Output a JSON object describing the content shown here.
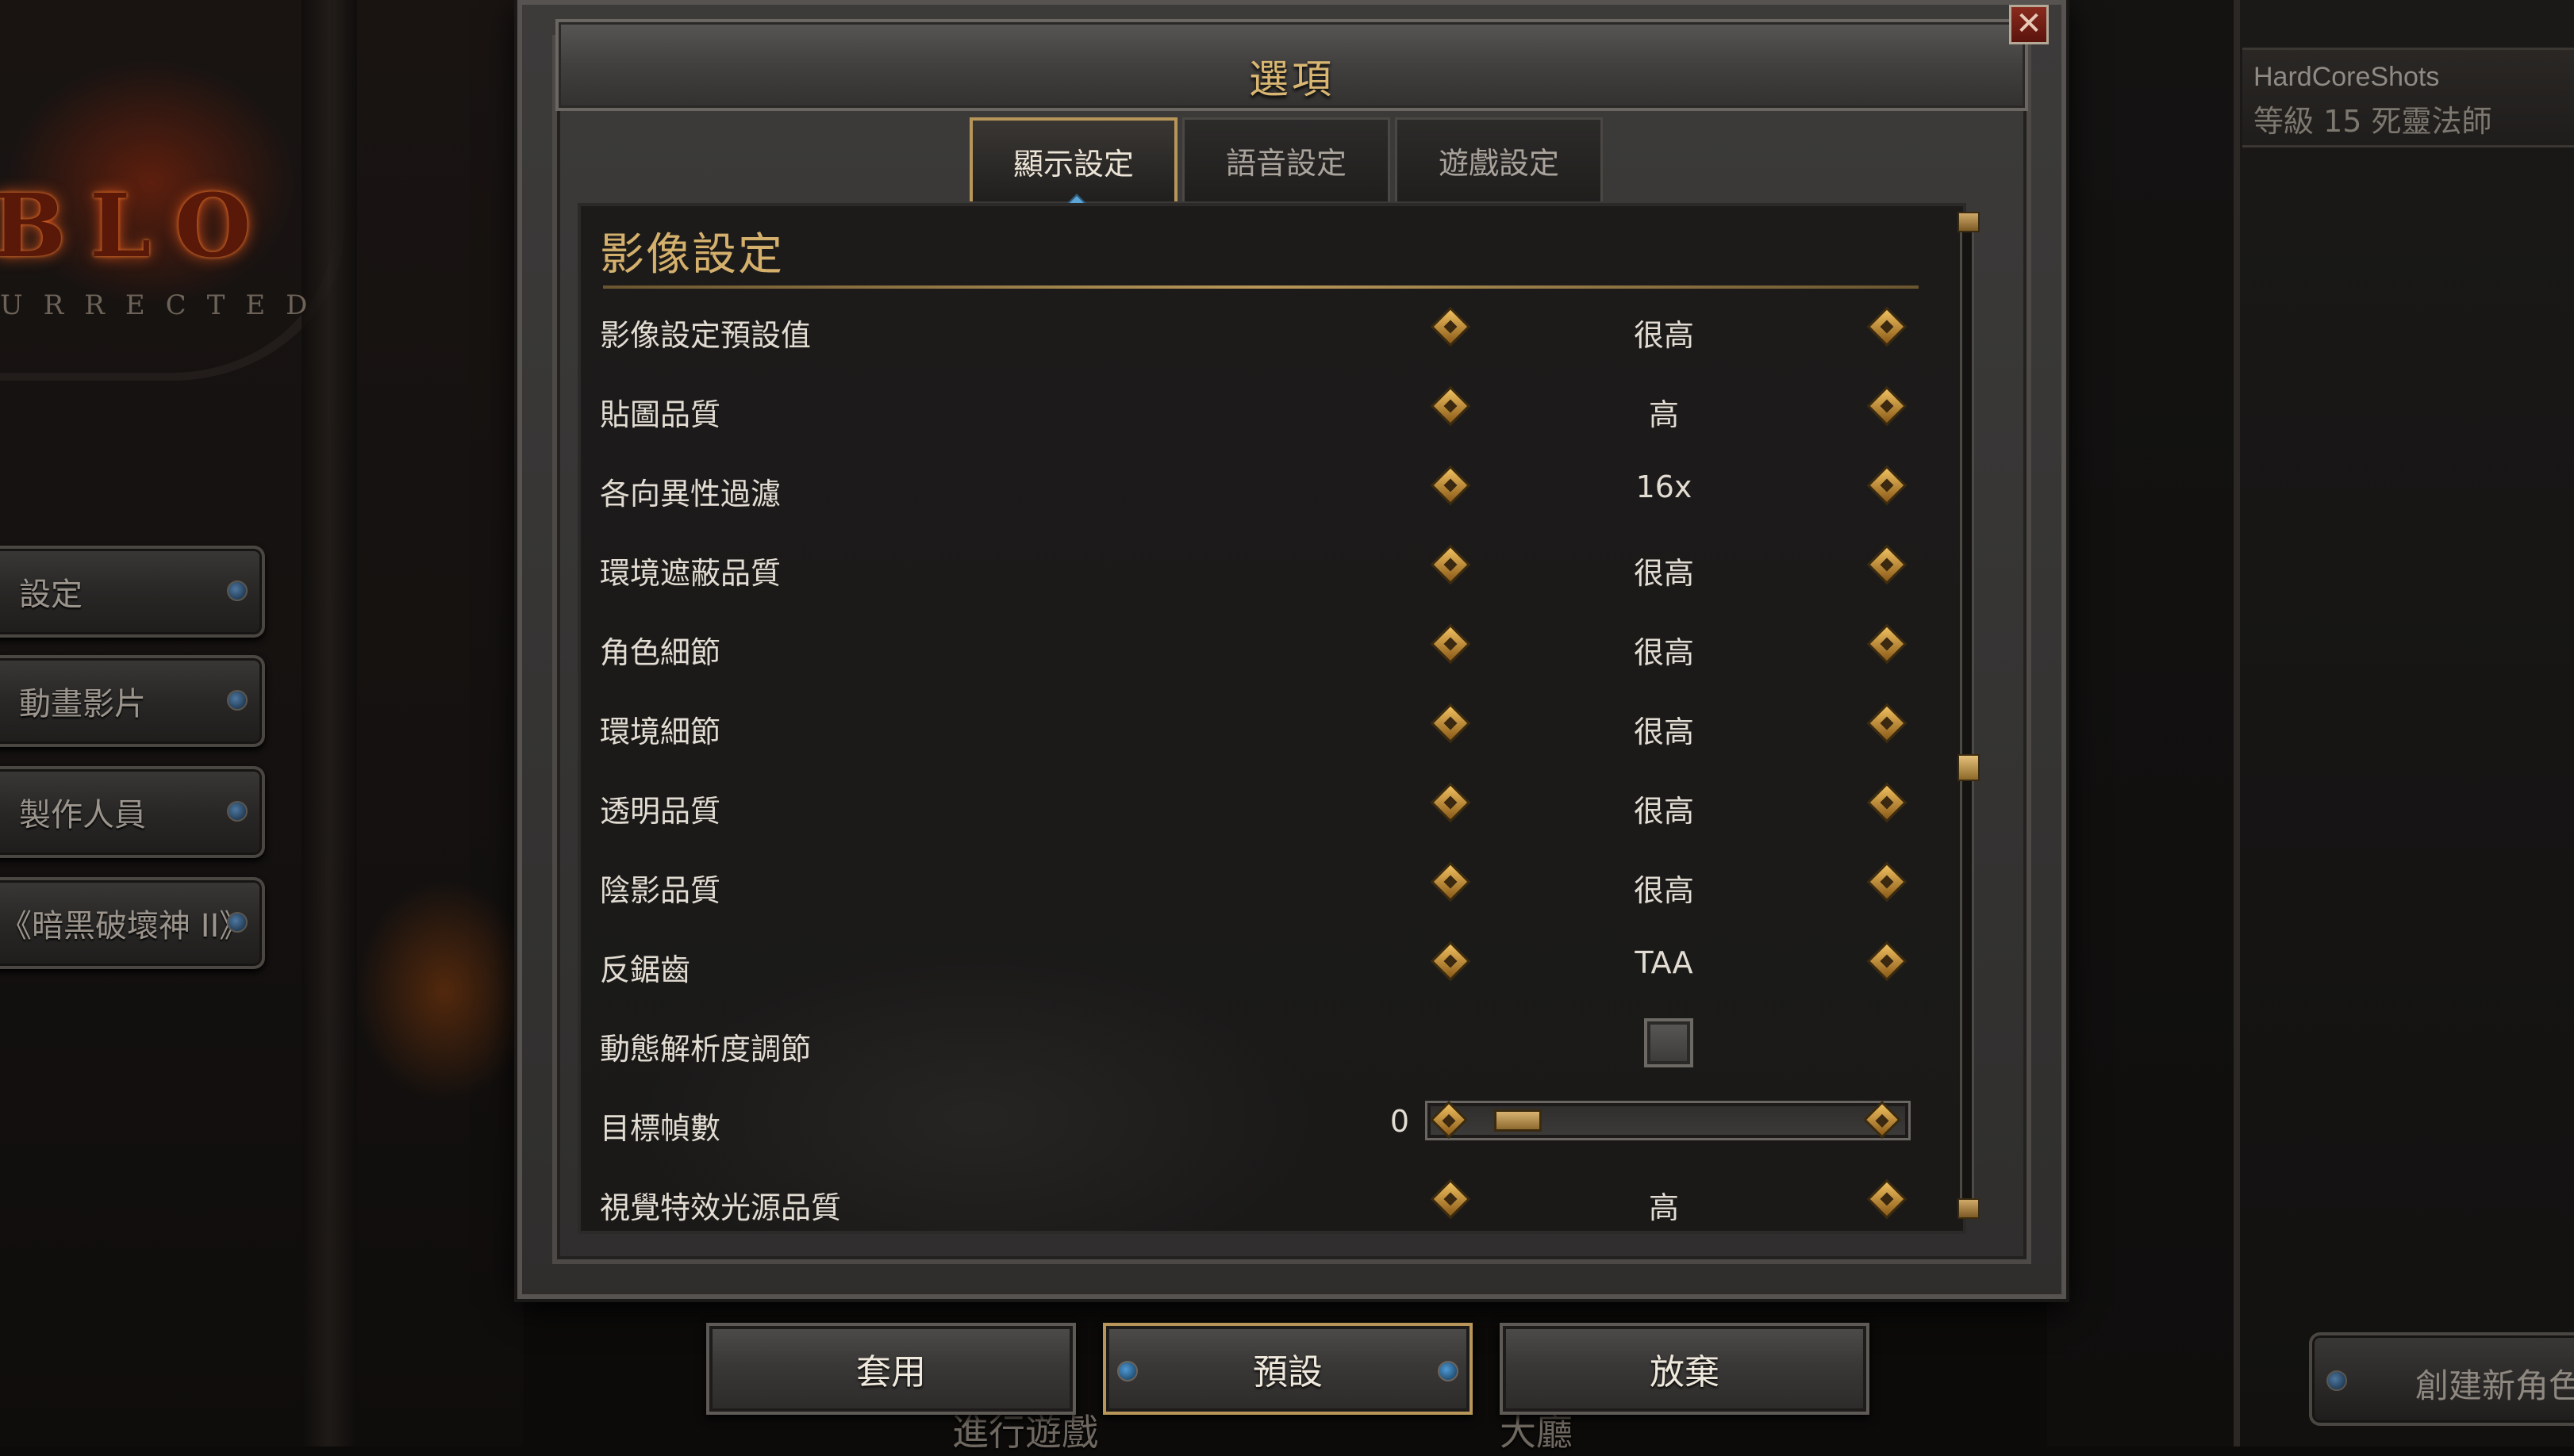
{
  "background": {
    "logo_text": "BLO",
    "logo_subtext": "URRECTED",
    "side_menu": [
      {
        "label": "設定"
      },
      {
        "label": "動畫影片"
      },
      {
        "label": "製作人員"
      },
      {
        "label": "《暗黑破壞神 II》"
      }
    ],
    "character": {
      "name": "HardCoreShots",
      "level_class": "等級 15 死靈法師"
    },
    "create_character_label": "創建新角色",
    "under_labels": {
      "play": "進行遊戲",
      "lobby": "大廳"
    }
  },
  "dialog": {
    "title": "選項",
    "close_symbol": "✕",
    "tabs": [
      {
        "label": "顯示設定",
        "active": true
      },
      {
        "label": "語音設定",
        "active": false
      },
      {
        "label": "遊戲設定",
        "active": false
      }
    ],
    "section_title": "影像設定",
    "settings": [
      {
        "label": "影像設定預設值",
        "value": "很高"
      },
      {
        "label": "貼圖品質",
        "value": "高"
      },
      {
        "label": "各向異性過濾",
        "value": "16x"
      },
      {
        "label": "環境遮蔽品質",
        "value": "很高"
      },
      {
        "label": "角色細節",
        "value": "很高"
      },
      {
        "label": "環境細節",
        "value": "很高"
      },
      {
        "label": "透明品質",
        "value": "很高"
      },
      {
        "label": "陰影品質",
        "value": "很高"
      },
      {
        "label": "反鋸齒",
        "value": "TAA"
      }
    ],
    "dynamic_resolution": {
      "label": "動態解析度調節",
      "checked": false
    },
    "target_fps": {
      "label": "目標幀數",
      "value": "0",
      "level": 0
    },
    "vfx_light": {
      "label": "視覺特效光源品質",
      "value": "高"
    },
    "buttons": {
      "apply": "套用",
      "default": "預設",
      "discard": "放棄"
    }
  },
  "colors": {
    "gold_title": "#d9b672",
    "accent_blue": "#5ba6d6",
    "close_red": "#8a2a1e"
  }
}
